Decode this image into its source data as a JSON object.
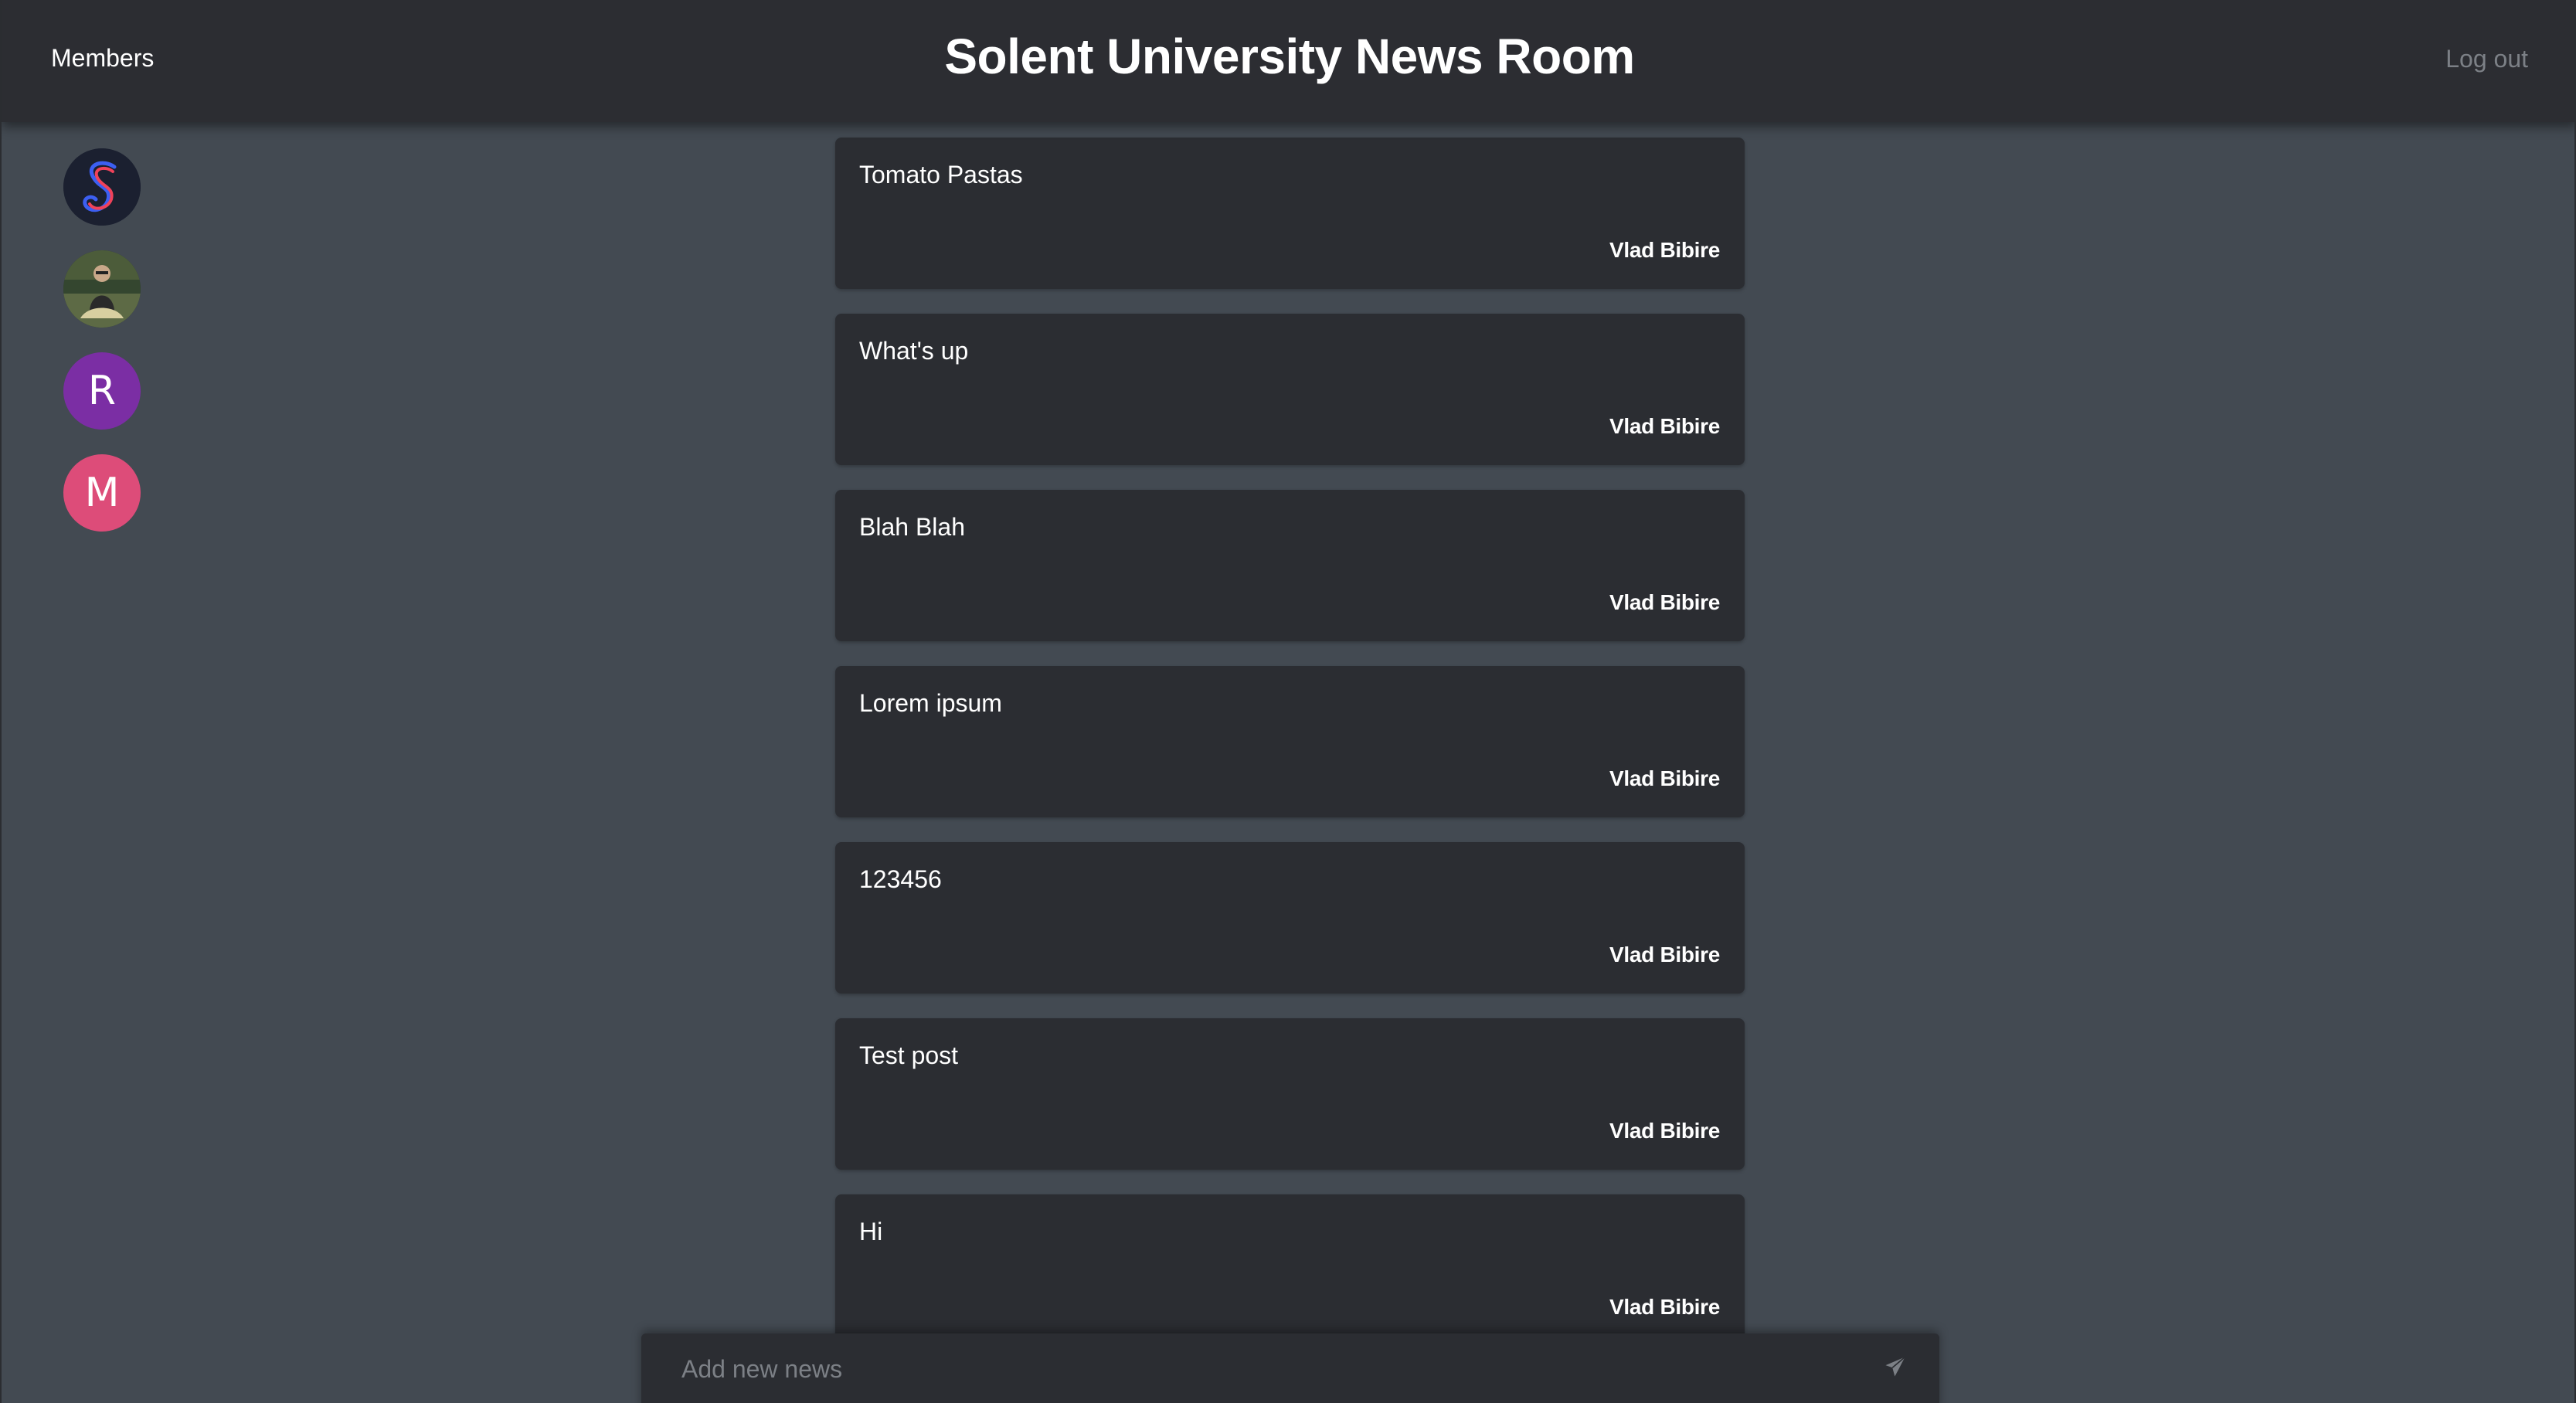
{
  "header": {
    "members_label": "Members",
    "title": "Solent University News Room",
    "logout_label": "Log out"
  },
  "sidebar": {
    "members": [
      {
        "type": "logo",
        "letter": "",
        "color": "#1b2030",
        "icon": "script-s-logo-icon"
      },
      {
        "type": "photo",
        "letter": "",
        "color": "#2e3d2c",
        "icon": "user-photo-icon"
      },
      {
        "type": "initial",
        "letter": "R",
        "color": "#7b2ea4",
        "icon": ""
      },
      {
        "type": "initial",
        "letter": "M",
        "color": "#dd4c79",
        "icon": ""
      }
    ]
  },
  "posts": [
    {
      "title": "Tomato Pastas",
      "author": "Vlad Bibire"
    },
    {
      "title": "What's up",
      "author": "Vlad Bibire"
    },
    {
      "title": "Blah Blah",
      "author": "Vlad Bibire"
    },
    {
      "title": "Lorem ipsum",
      "author": "Vlad Bibire"
    },
    {
      "title": "123456",
      "author": "Vlad Bibire"
    },
    {
      "title": "Test post",
      "author": "Vlad Bibire"
    },
    {
      "title": "Hi",
      "author": "Vlad Bibire"
    }
  ],
  "composer": {
    "placeholder": "Add new news",
    "value": "",
    "send_icon": "paper-plane-icon"
  },
  "colors": {
    "background": "#434a52",
    "header": "#2c2d32",
    "card": "#2b2d32",
    "muted_text": "#7c8086"
  }
}
